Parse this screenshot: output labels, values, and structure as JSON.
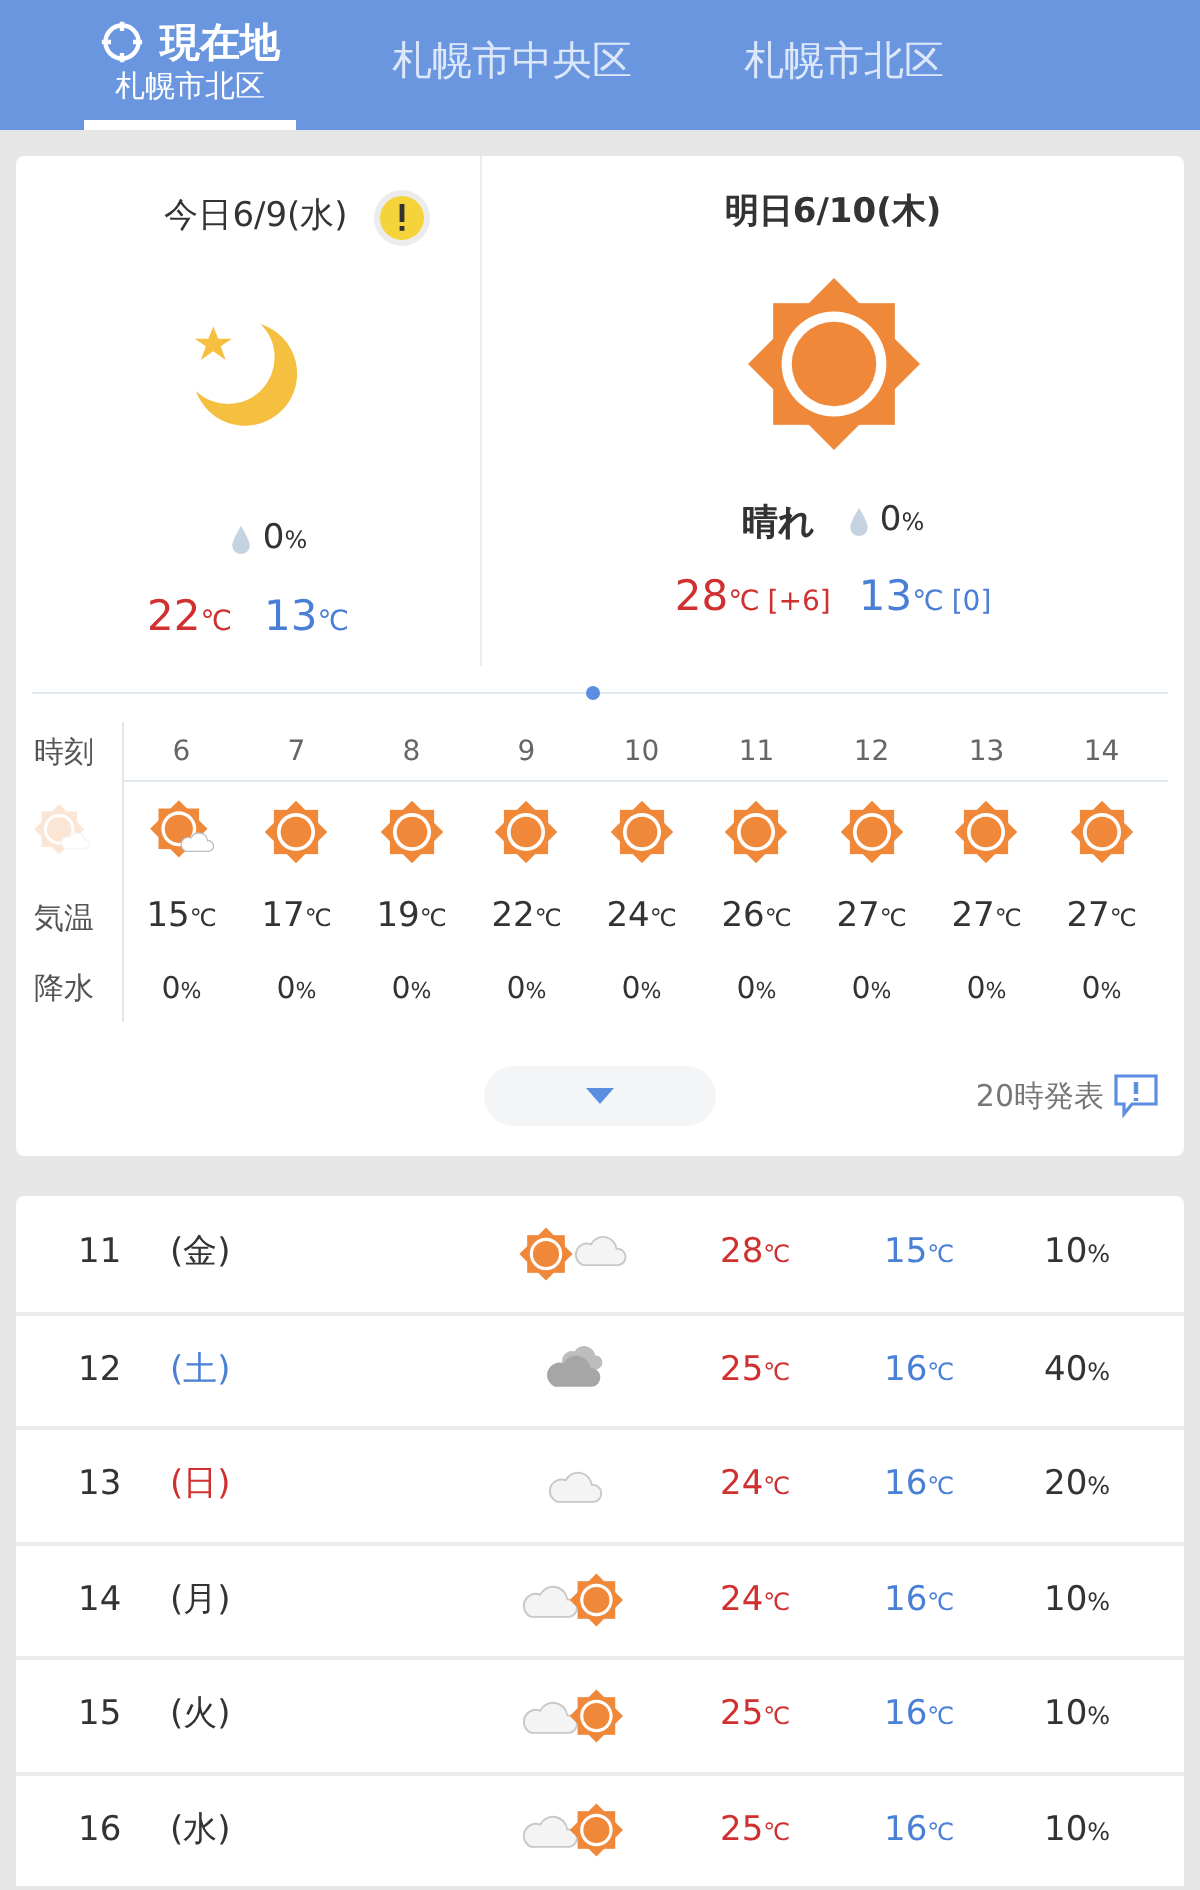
{
  "tabs": [
    {
      "title": "現在地",
      "subtitle": "札幌市北区",
      "kind": "current",
      "selected": true
    },
    {
      "title": "札幌市中央区",
      "kind": "place",
      "selected": false
    },
    {
      "title": "札幌市北区",
      "kind": "place",
      "selected": false
    }
  ],
  "today": {
    "date": "今日6/9(水)",
    "warning": true,
    "kind": "moon",
    "rain": {
      "value": "0",
      "unit": "%"
    },
    "high": {
      "value": "22",
      "unit": "℃"
    },
    "low": {
      "value": "13",
      "unit": "℃"
    }
  },
  "tomorrow": {
    "date": "明日6/10(木)",
    "kind": "sun",
    "weather": "晴れ",
    "rain": {
      "value": "0",
      "unit": "%"
    },
    "high": {
      "value": "28",
      "unit": "℃",
      "diff": "[+6]"
    },
    "low": {
      "value": "13",
      "unit": "℃",
      "diff": "[0]"
    }
  },
  "hourly": {
    "labels": {
      "time": "時刻",
      "temp": "気温",
      "rain": "降水"
    },
    "hours": [
      {
        "hour": "6",
        "kind": "suncloud",
        "temp": "15",
        "temp_unit": "℃",
        "rain": "0",
        "rain_unit": "%"
      },
      {
        "hour": "7",
        "kind": "sun",
        "temp": "17",
        "temp_unit": "℃",
        "rain": "0",
        "rain_unit": "%"
      },
      {
        "hour": "8",
        "kind": "sun",
        "temp": "19",
        "temp_unit": "℃",
        "rain": "0",
        "rain_unit": "%"
      },
      {
        "hour": "9",
        "kind": "sun",
        "temp": "22",
        "temp_unit": "℃",
        "rain": "0",
        "rain_unit": "%"
      },
      {
        "hour": "10",
        "kind": "sun",
        "temp": "24",
        "temp_unit": "℃",
        "rain": "0",
        "rain_unit": "%"
      },
      {
        "hour": "11",
        "kind": "sun",
        "temp": "26",
        "temp_unit": "℃",
        "rain": "0",
        "rain_unit": "%"
      },
      {
        "hour": "12",
        "kind": "sun",
        "temp": "27",
        "temp_unit": "℃",
        "rain": "0",
        "rain_unit": "%"
      },
      {
        "hour": "13",
        "kind": "sun",
        "temp": "27",
        "temp_unit": "℃",
        "rain": "0",
        "rain_unit": "%"
      },
      {
        "hour": "14",
        "kind": "sun",
        "temp": "27",
        "temp_unit": "℃",
        "rain": "0",
        "rain_unit": "%"
      }
    ]
  },
  "issued": "20時発表",
  "weekly": [
    {
      "day": "11",
      "weekday": "(金)",
      "color": "#333333",
      "kind": "sunthencloud",
      "high": "28",
      "high_unit": "℃",
      "low": "15",
      "low_unit": "℃",
      "rain": "10",
      "rain_unit": "%"
    },
    {
      "day": "12",
      "weekday": "(土)",
      "color": "#4a7fd6",
      "kind": "overcast",
      "high": "25",
      "high_unit": "℃",
      "low": "16",
      "low_unit": "℃",
      "rain": "40",
      "rain_unit": "%"
    },
    {
      "day": "13",
      "weekday": "(日)",
      "color": "#d03030",
      "kind": "cloud",
      "high": "24",
      "high_unit": "℃",
      "low": "16",
      "low_unit": "℃",
      "rain": "20",
      "rain_unit": "%"
    },
    {
      "day": "14",
      "weekday": "(月)",
      "color": "#333333",
      "kind": "cloudthensun",
      "high": "24",
      "high_unit": "℃",
      "low": "16",
      "low_unit": "℃",
      "rain": "10",
      "rain_unit": "%"
    },
    {
      "day": "15",
      "weekday": "(火)",
      "color": "#333333",
      "kind": "cloudthensun",
      "high": "25",
      "high_unit": "℃",
      "low": "16",
      "low_unit": "℃",
      "rain": "10",
      "rain_unit": "%"
    },
    {
      "day": "16",
      "weekday": "(水)",
      "color": "#333333",
      "kind": "cloudthensun",
      "high": "25",
      "high_unit": "℃",
      "low": "16",
      "low_unit": "℃",
      "rain": "10",
      "rain_unit": "%"
    }
  ]
}
